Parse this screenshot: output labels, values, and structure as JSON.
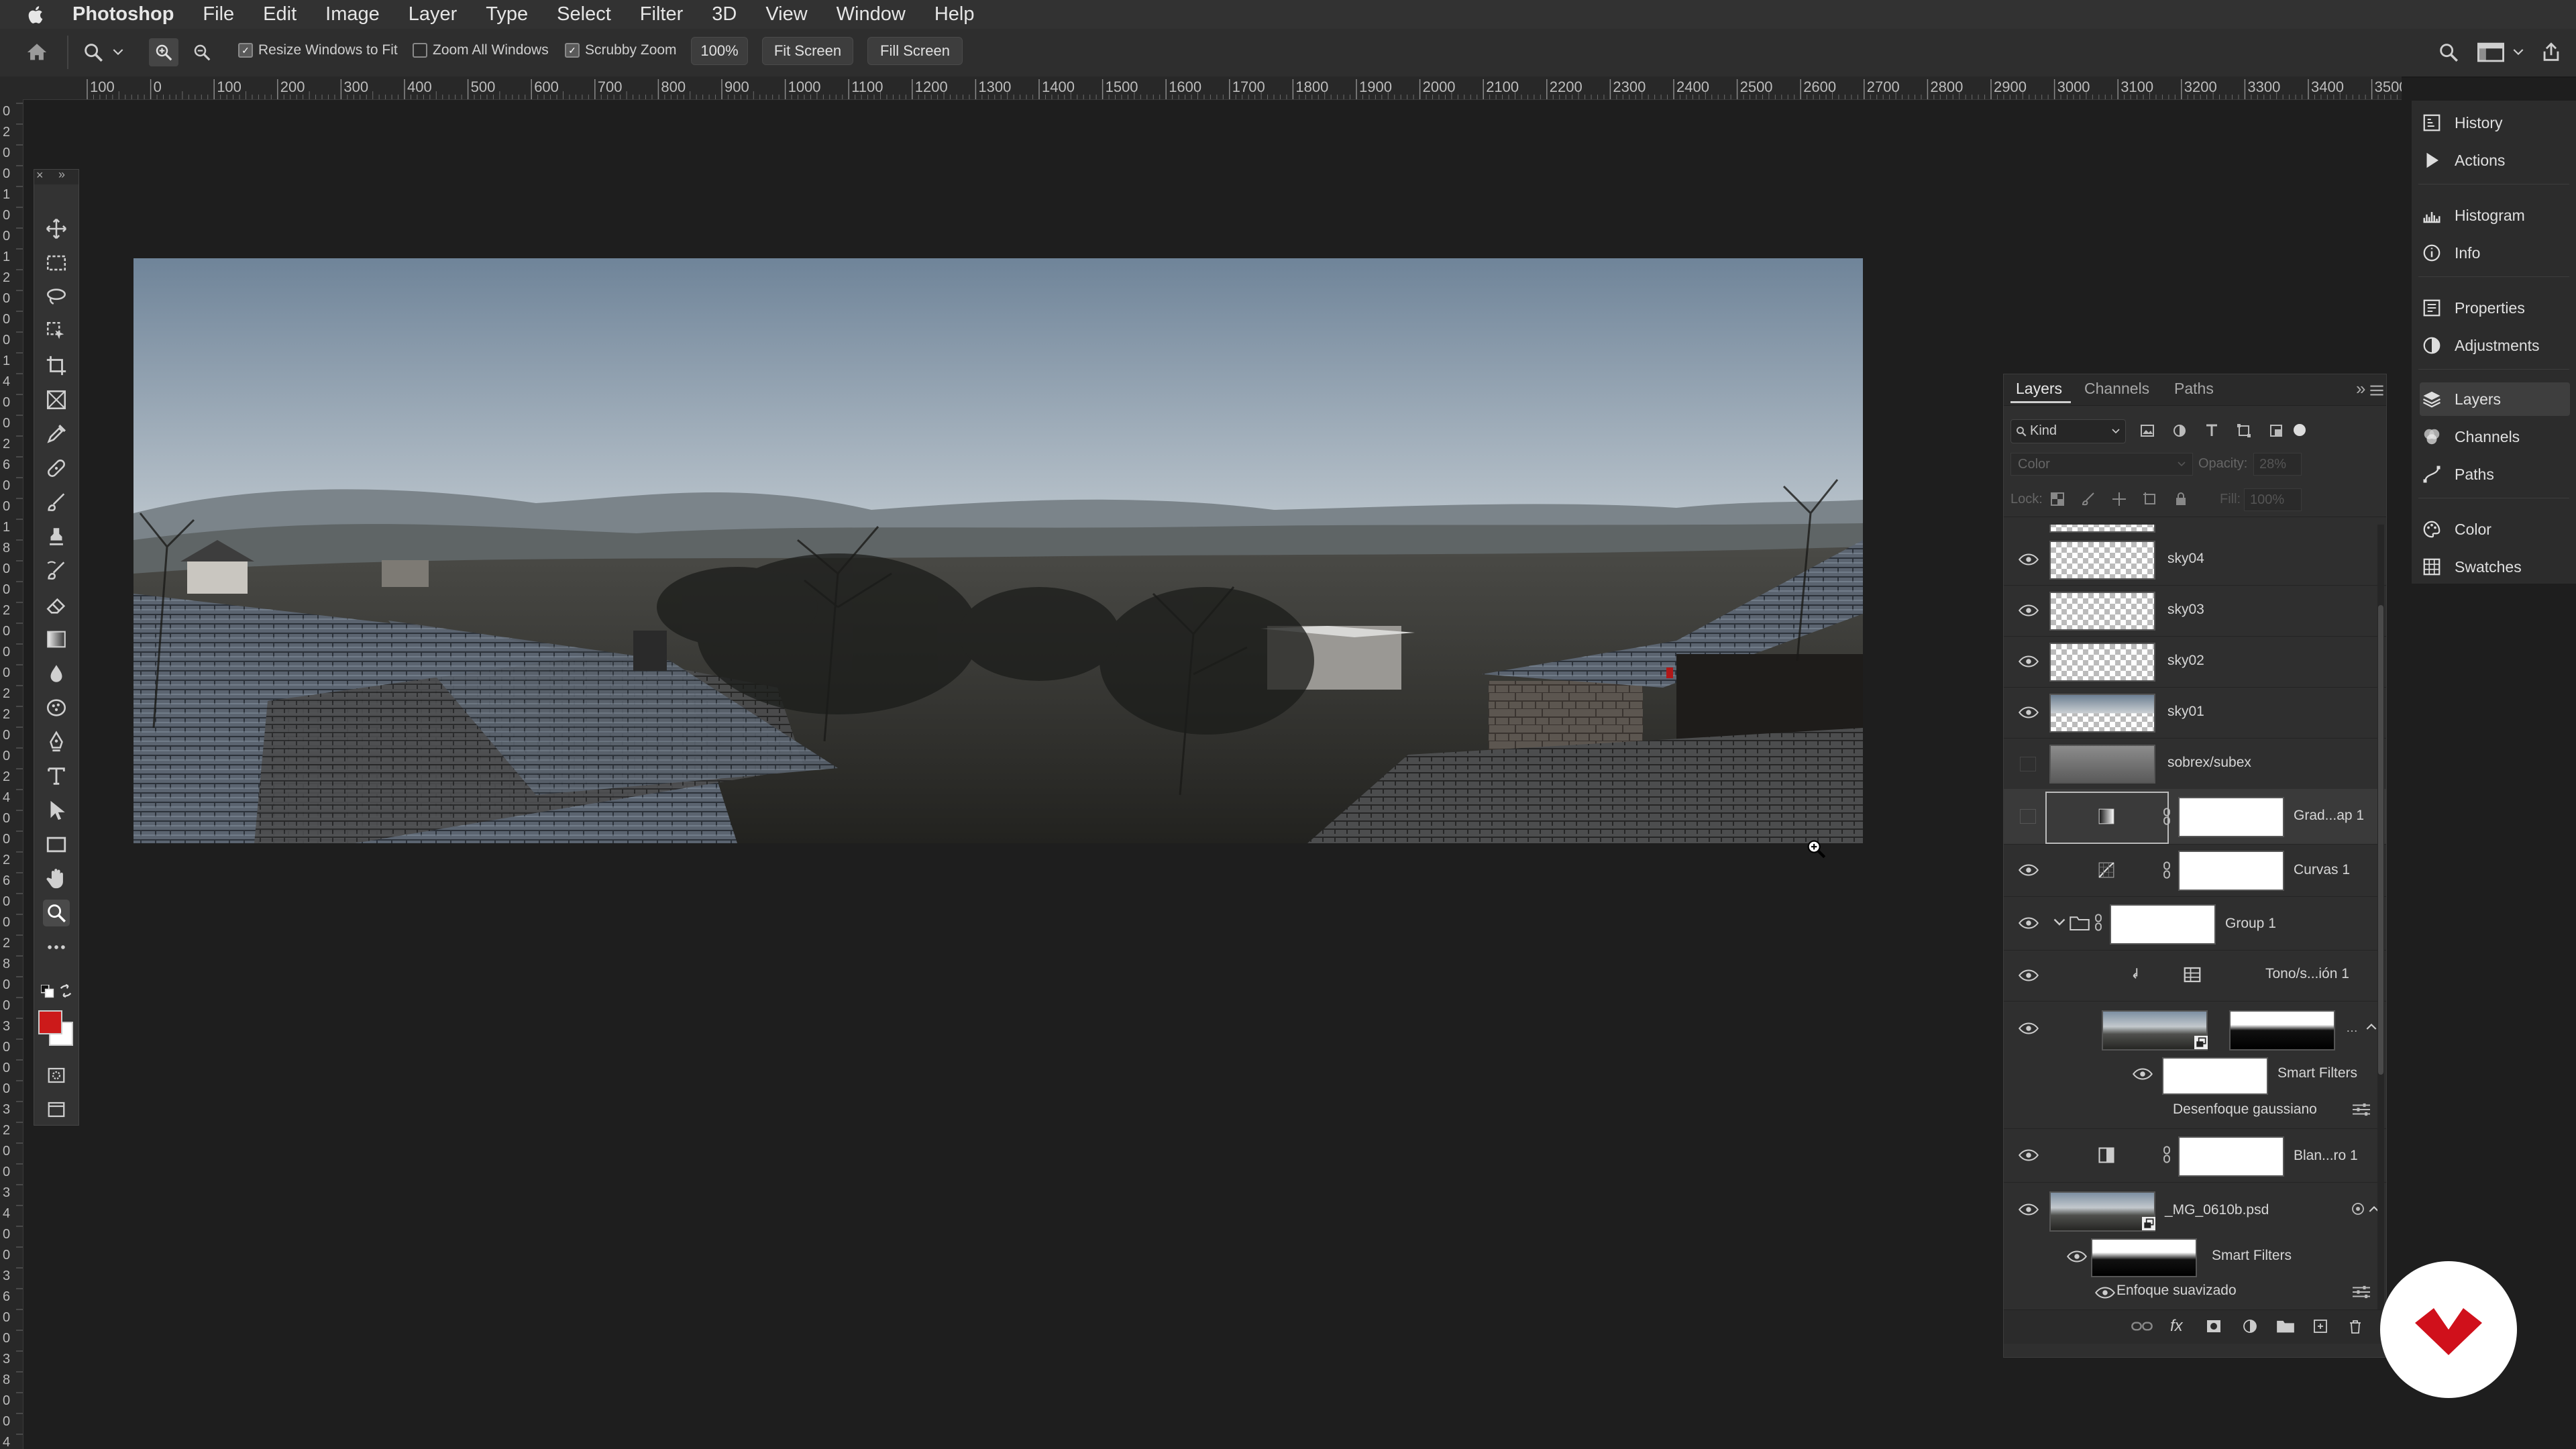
{
  "menubar": {
    "app": "Photoshop",
    "items": [
      "File",
      "Edit",
      "Image",
      "Layer",
      "Type",
      "Select",
      "Filter",
      "3D",
      "View",
      "Window",
      "Help"
    ]
  },
  "options": {
    "resize_windows": "Resize Windows to Fit",
    "zoom_all": "Zoom All Windows",
    "scrubby": "Scrubby Zoom",
    "zoom_value": "100%",
    "fit_screen": "Fit Screen",
    "fill_screen": "Fill Screen"
  },
  "ruler": {
    "top_ticks": [
      "100",
      "0",
      "100",
      "200",
      "300",
      "400",
      "500",
      "600",
      "700",
      "800",
      "900",
      "1000",
      "1100",
      "1200",
      "1300",
      "1400",
      "1500",
      "1600",
      "1700",
      "1800",
      "1900",
      "2000",
      "2100",
      "2200",
      "2300",
      "2400",
      "2500",
      "2600",
      "2700",
      "2800",
      "2900",
      "3000",
      "3100",
      "3200",
      "3300",
      "3400",
      "3500"
    ],
    "left_ticks": [
      "0",
      "2",
      "0",
      "0",
      "1",
      "0",
      "0",
      "1",
      "2",
      "0",
      "0",
      "0",
      "1",
      "4",
      "0",
      "0",
      "2",
      "6",
      "0",
      "0",
      "1",
      "8",
      "0",
      "0",
      "2",
      "0",
      "0",
      "0",
      "2",
      "2",
      "0",
      "0",
      "2",
      "4",
      "0",
      "0",
      "2",
      "6",
      "0",
      "0",
      "2",
      "8",
      "0",
      "0",
      "3",
      "0",
      "0",
      "0",
      "3",
      "2",
      "0",
      "0",
      "3",
      "4",
      "0",
      "0",
      "3",
      "6",
      "0",
      "0",
      "3",
      "8",
      "0",
      "0",
      "4"
    ]
  },
  "layers_panel": {
    "tabs": [
      "Layers",
      "Channels",
      "Paths"
    ],
    "filter_kind": "Kind",
    "blend_mode": "Color",
    "opacity_label": "Opacity:",
    "opacity_value": "28%",
    "lock_label": "Lock:",
    "fill_label": "Fill:",
    "fill_value": "100%",
    "layers": [
      {
        "name": "sky04"
      },
      {
        "name": "sky03"
      },
      {
        "name": "sky02"
      },
      {
        "name": "sky01"
      },
      {
        "name": "sobrex/subex"
      },
      {
        "name": "Grad...ap 1"
      },
      {
        "name": "Curvas 1"
      },
      {
        "name": "Group 1"
      },
      {
        "name": "Tono/s...ión 1"
      },
      {
        "name": "Smart Filters"
      },
      {
        "name": "Desenfoque gaussiano"
      },
      {
        "name": "Blan...ro 1"
      },
      {
        "name": "_MG_0610b.psd"
      },
      {
        "name": "Smart Filters"
      },
      {
        "name": "Enfoque suavizado"
      }
    ]
  },
  "dock": {
    "items": [
      "History",
      "Actions",
      "Histogram",
      "Info",
      "Properties",
      "Adjustments",
      "Layers",
      "Channels",
      "Paths",
      "Color",
      "Swatches"
    ]
  },
  "colors": {
    "foreground": "#cc1a1a",
    "background": "#ffffff",
    "brand_badge": "#d0101b"
  }
}
